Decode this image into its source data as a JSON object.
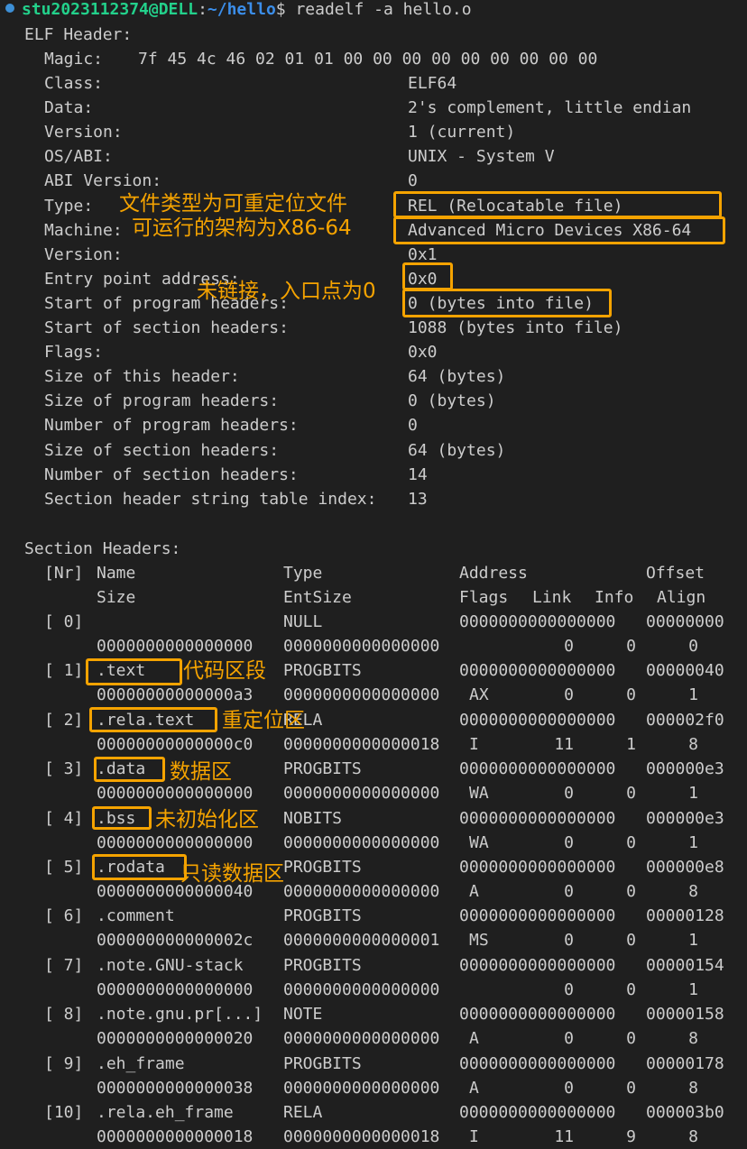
{
  "prompt": {
    "user_host": "stu2023112374@DELL",
    "sep": ":",
    "path": "~/hello",
    "symbol": "$",
    "command": " readelf -a hello.o"
  },
  "elf_header": {
    "title": "ELF Header:",
    "magic_label": "Magic:",
    "magic_value": "7f 45 4c 46 02 01 01 00 00 00 00 00 00 00 00 00",
    "fields": [
      {
        "key": "Class:",
        "value": "ELF64"
      },
      {
        "key": "Data:",
        "value": "2's complement, little endian"
      },
      {
        "key": "Version:",
        "value": "1 (current)"
      },
      {
        "key": "OS/ABI:",
        "value": "UNIX - System V"
      },
      {
        "key": "ABI Version:",
        "value": "0"
      },
      {
        "key": "Type:",
        "value": "REL (Relocatable file)"
      },
      {
        "key": "Machine:",
        "value": "Advanced Micro Devices X86-64"
      },
      {
        "key": "Version:",
        "value": "0x1"
      },
      {
        "key": "Entry point address:",
        "value": "0x0"
      },
      {
        "key": "Start of program headers:",
        "value": "0 (bytes into file)"
      },
      {
        "key": "Start of section headers:",
        "value": "1088 (bytes into file)"
      },
      {
        "key": "Flags:",
        "value": "0x0"
      },
      {
        "key": "Size of this header:",
        "value": "64 (bytes)"
      },
      {
        "key": "Size of program headers:",
        "value": "0 (bytes)"
      },
      {
        "key": "Number of program headers:",
        "value": "0"
      },
      {
        "key": "Size of section headers:",
        "value": "64 (bytes)"
      },
      {
        "key": "Number of section headers:",
        "value": "14"
      },
      {
        "key": "Section header string table index:",
        "value": "13"
      }
    ]
  },
  "section_headers": {
    "title": "Section Headers:",
    "header1": {
      "nr": "[Nr]",
      "name": "Name",
      "type": "Type",
      "address": "Address",
      "offset": "Offset"
    },
    "header2": {
      "size": "Size",
      "entsize": "EntSize",
      "flags": "Flags",
      "link": "Link",
      "info": "Info",
      "align": "Align"
    },
    "rows": [
      {
        "nr": "[ 0]",
        "name": "",
        "type": "NULL",
        "address": "0000000000000000",
        "offset": "00000000",
        "size": "0000000000000000",
        "entsize": "0000000000000000",
        "flags": "",
        "link": "0",
        "info": "0",
        "align": "0"
      },
      {
        "nr": "[ 1]",
        "name": ".text",
        "type": "PROGBITS",
        "address": "0000000000000000",
        "offset": "00000040",
        "size": "00000000000000a3",
        "entsize": "0000000000000000",
        "flags": "AX",
        "link": "0",
        "info": "0",
        "align": "1"
      },
      {
        "nr": "[ 2]",
        "name": ".rela.text",
        "type": "RELA",
        "address": "0000000000000000",
        "offset": "000002f0",
        "size": "00000000000000c0",
        "entsize": "0000000000000018",
        "flags": "I",
        "link": "11",
        "info": "1",
        "align": "8"
      },
      {
        "nr": "[ 3]",
        "name": ".data",
        "type": "PROGBITS",
        "address": "0000000000000000",
        "offset": "000000e3",
        "size": "0000000000000000",
        "entsize": "0000000000000000",
        "flags": "WA",
        "link": "0",
        "info": "0",
        "align": "1"
      },
      {
        "nr": "[ 4]",
        "name": ".bss",
        "type": "NOBITS",
        "address": "0000000000000000",
        "offset": "000000e3",
        "size": "0000000000000000",
        "entsize": "0000000000000000",
        "flags": "WA",
        "link": "0",
        "info": "0",
        "align": "1"
      },
      {
        "nr": "[ 5]",
        "name": ".rodata",
        "type": "PROGBITS",
        "address": "0000000000000000",
        "offset": "000000e8",
        "size": "0000000000000040",
        "entsize": "0000000000000000",
        "flags": "A",
        "link": "0",
        "info": "0",
        "align": "8"
      },
      {
        "nr": "[ 6]",
        "name": ".comment",
        "type": "PROGBITS",
        "address": "0000000000000000",
        "offset": "00000128",
        "size": "000000000000002c",
        "entsize": "0000000000000001",
        "flags": "MS",
        "link": "0",
        "info": "0",
        "align": "1"
      },
      {
        "nr": "[ 7]",
        "name": ".note.GNU-stack",
        "type": "PROGBITS",
        "address": "0000000000000000",
        "offset": "00000154",
        "size": "0000000000000000",
        "entsize": "0000000000000000",
        "flags": "",
        "link": "0",
        "info": "0",
        "align": "1"
      },
      {
        "nr": "[ 8]",
        "name": ".note.gnu.pr[...]",
        "type": "NOTE",
        "address": "0000000000000000",
        "offset": "00000158",
        "size": "0000000000000020",
        "entsize": "0000000000000000",
        "flags": "A",
        "link": "0",
        "info": "0",
        "align": "8"
      },
      {
        "nr": "[ 9]",
        "name": ".eh_frame",
        "type": "PROGBITS",
        "address": "0000000000000000",
        "offset": "00000178",
        "size": "0000000000000038",
        "entsize": "0000000000000000",
        "flags": "A",
        "link": "0",
        "info": "0",
        "align": "8"
      },
      {
        "nr": "[10]",
        "name": ".rela.eh_frame",
        "type": "RELA",
        "address": "0000000000000000",
        "offset": "000003b0",
        "size": "0000000000000018",
        "entsize": "0000000000000018",
        "flags": "I",
        "link": "11",
        "info": "9",
        "align": "8"
      }
    ]
  },
  "annotations": {
    "type": "文件类型为可重定位文件",
    "machine": "可运行的架构为X86-64",
    "entry": "未链接，入口点为0",
    "text": "代码区段",
    "rela_text": "重定位区",
    "data": "数据区",
    "bss": "未初始化区",
    "rodata": "只读数据区"
  },
  "colors": {
    "background": "#1f1f1f",
    "text": "#cccccc",
    "user": "#23d18b",
    "path": "#3b8eea",
    "annotation": "#f5a300"
  }
}
